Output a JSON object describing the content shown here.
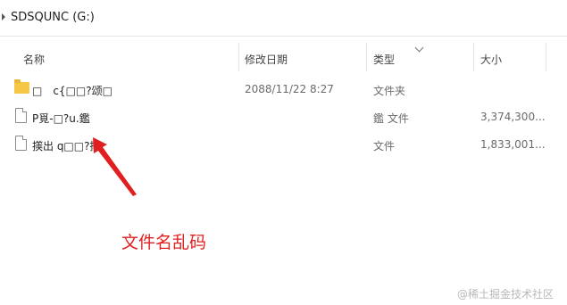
{
  "address_bar": {
    "location": "SDSQUNC (G:)"
  },
  "columns": {
    "name": "名称",
    "modified": "修改日期",
    "type": "类型",
    "size": "大小"
  },
  "files": [
    {
      "icon": "folder-icon",
      "name": "□　c{□□?颂□",
      "modified": "2088/11/22 8:27",
      "type": "文件夹",
      "size": ""
    },
    {
      "icon": "file-icon",
      "name": "P覓-□?u.鑑",
      "modified": "",
      "type": "鑑 文件",
      "size": "3,374,300..."
    },
    {
      "icon": "file-icon",
      "name": "擌出 q□□?撦",
      "modified": "",
      "type": "文件",
      "size": "1,833,001..."
    }
  ],
  "annotation": {
    "text": "文件名乱码",
    "color": "#e02020"
  },
  "watermark": "@稀土掘金技术社区"
}
